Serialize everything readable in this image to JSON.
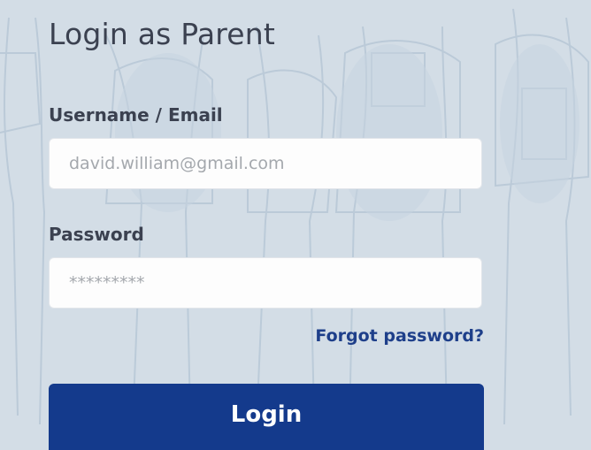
{
  "form": {
    "title": "Login as Parent",
    "username": {
      "label": "Username / Email",
      "placeholder": "david.william@gmail.com"
    },
    "password": {
      "label": "Password",
      "placeholder": "*********"
    },
    "forgot_label": "Forgot password?",
    "login_label": "Login"
  },
  "colors": {
    "background": "#d3dde6",
    "primary_button": "#143a8c",
    "link": "#1e3f8a",
    "text": "#3b4150"
  }
}
